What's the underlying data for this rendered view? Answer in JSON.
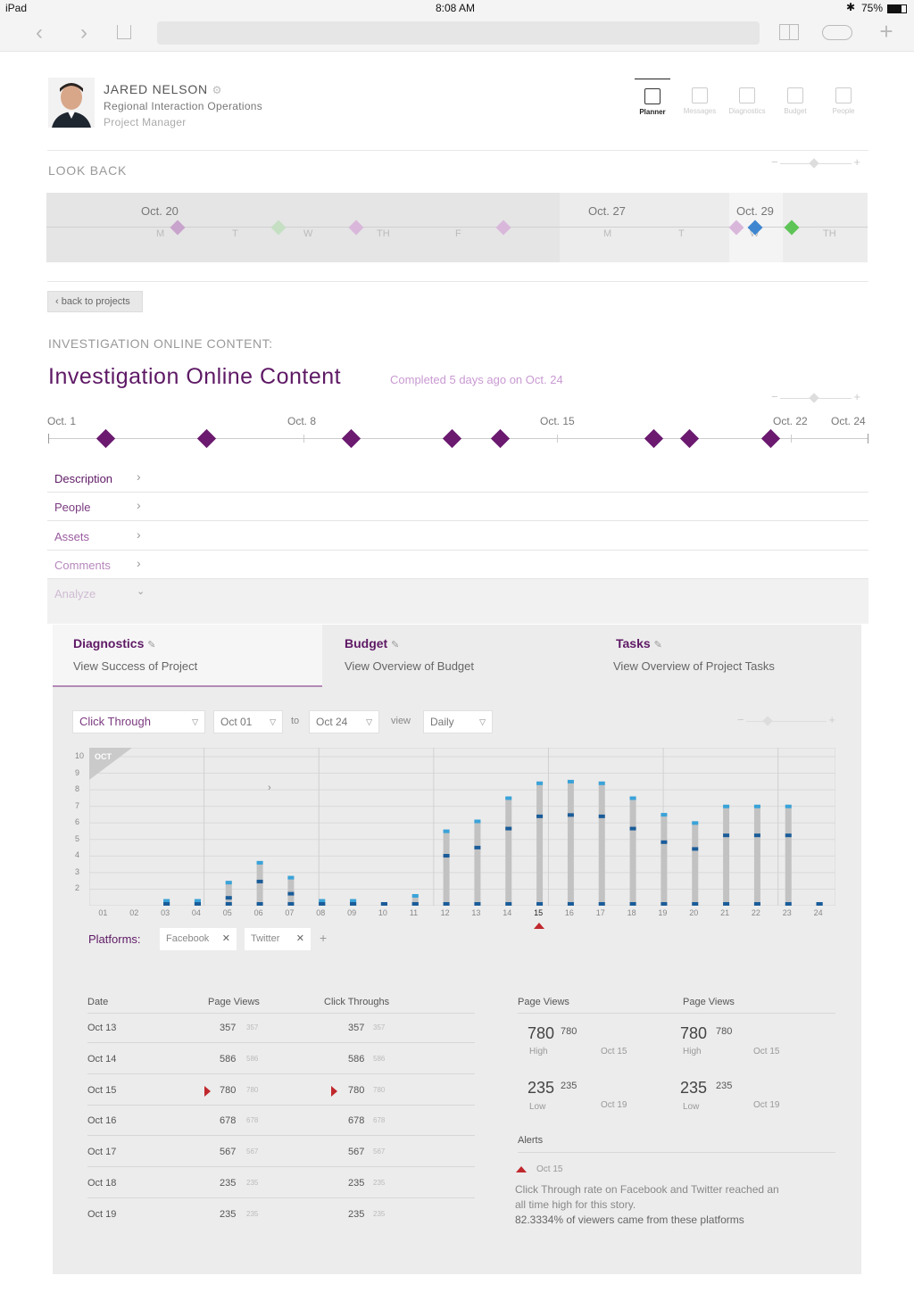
{
  "status": {
    "device": "iPad",
    "time": "8:08 AM",
    "battery": "75%"
  },
  "profile": {
    "name": "JARED NELSON",
    "org": "Regional Interaction Operations",
    "role": "Project Manager"
  },
  "topnav": [
    {
      "label": "Planner",
      "active": true
    },
    {
      "label": "Messages",
      "active": false
    },
    {
      "label": "Diagnostics",
      "active": false
    },
    {
      "label": "Budget",
      "active": false
    },
    {
      "label": "People",
      "active": false
    }
  ],
  "lookback": {
    "title": "LOOK BACK",
    "dates": [
      "Oct. 20",
      "Oct. 27",
      "Oct. 29"
    ],
    "days": [
      "M",
      "T",
      "W",
      "TH",
      "F",
      "M",
      "T",
      "W",
      "TH"
    ]
  },
  "project": {
    "back_label": "back to projects",
    "subtitle": "INVESTIGATION ONLINE CONTENT:",
    "title": "Investigation Online Content",
    "completed": "Completed 5 days ago on Oct. 24",
    "timeline_dates": [
      "Oct. 1",
      "Oct. 8",
      "Oct. 15",
      "Oct. 22",
      "Oct. 24"
    ]
  },
  "accordion": [
    "Description",
    "People",
    "Assets",
    "Comments",
    "Analyze"
  ],
  "tabs": [
    {
      "title": "Diagnostics",
      "desc": "View Success of Project"
    },
    {
      "title": "Budget",
      "desc": "View Overview of Budget"
    },
    {
      "title": "Tasks",
      "desc": "View Overview of Project Tasks"
    }
  ],
  "filters": {
    "metric": "Click Through",
    "from": "Oct 01",
    "to_label": "to",
    "to": "Oct 24",
    "view_label": "view",
    "view": "Daily"
  },
  "chart_data": {
    "type": "bar",
    "month_label": "OCT",
    "x": [
      "01",
      "02",
      "03",
      "04",
      "05",
      "06",
      "07",
      "08",
      "09",
      "10",
      "11",
      "12",
      "13",
      "14",
      "15",
      "16",
      "17",
      "18",
      "19",
      "20",
      "21",
      "22",
      "23",
      "24"
    ],
    "yticks": [
      2,
      3,
      4,
      5,
      6,
      7,
      8,
      9,
      10
    ],
    "ylim": [
      1,
      10
    ],
    "values": [
      0,
      0,
      1.4,
      1.4,
      2.5,
      3.7,
      2.8,
      1.4,
      1.4,
      1.2,
      1.7,
      5.6,
      6.2,
      7.6,
      8.5,
      8.6,
      8.5,
      7.6,
      6.6,
      6.1,
      7.1,
      7.1,
      7.1,
      1.2
    ],
    "marker_day": "15"
  },
  "platforms": {
    "label": "Platforms:",
    "items": [
      "Facebook",
      "Twitter"
    ]
  },
  "table": {
    "headers": [
      "Date",
      "Page Views",
      "Click Throughs"
    ],
    "rows": [
      {
        "date": "Oct 13",
        "pv": "357",
        "ct": "357",
        "flag": false
      },
      {
        "date": "Oct 14",
        "pv": "586",
        "ct": "586",
        "flag": false
      },
      {
        "date": "Oct 15",
        "pv": "780",
        "ct": "780",
        "flag": true
      },
      {
        "date": "Oct 16",
        "pv": "678",
        "ct": "678",
        "flag": false
      },
      {
        "date": "Oct 17",
        "pv": "567",
        "ct": "567",
        "flag": false
      },
      {
        "date": "Oct 18",
        "pv": "235",
        "ct": "235",
        "flag": false
      },
      {
        "date": "Oct 19",
        "pv": "235",
        "ct": "235",
        "flag": false
      }
    ]
  },
  "stats": [
    {
      "title": "Page Views",
      "high": "780",
      "high_label": "High",
      "high_date": "Oct 15",
      "low": "235",
      "low_label": "Low",
      "low_date": "Oct 19"
    },
    {
      "title": "Page Views",
      "high": "780",
      "high_label": "High",
      "high_date": "Oct 15",
      "low": "235",
      "low_label": "Low",
      "low_date": "Oct 19"
    }
  ],
  "alerts": {
    "title": "Alerts",
    "date": "Oct 15",
    "line1": "Click Through rate on Facebook and Twitter reached an",
    "line2": "all time high for this story.",
    "line3": "82.3334% of viewers came from these platforms"
  },
  "colors": {
    "purple": "#5e1965",
    "diamond": "#6b1a70",
    "bar": "#c2c2c2",
    "bar_top": "#3aa3d9",
    "bar_mark": "#1a5c99",
    "alert": "#c0282d"
  }
}
